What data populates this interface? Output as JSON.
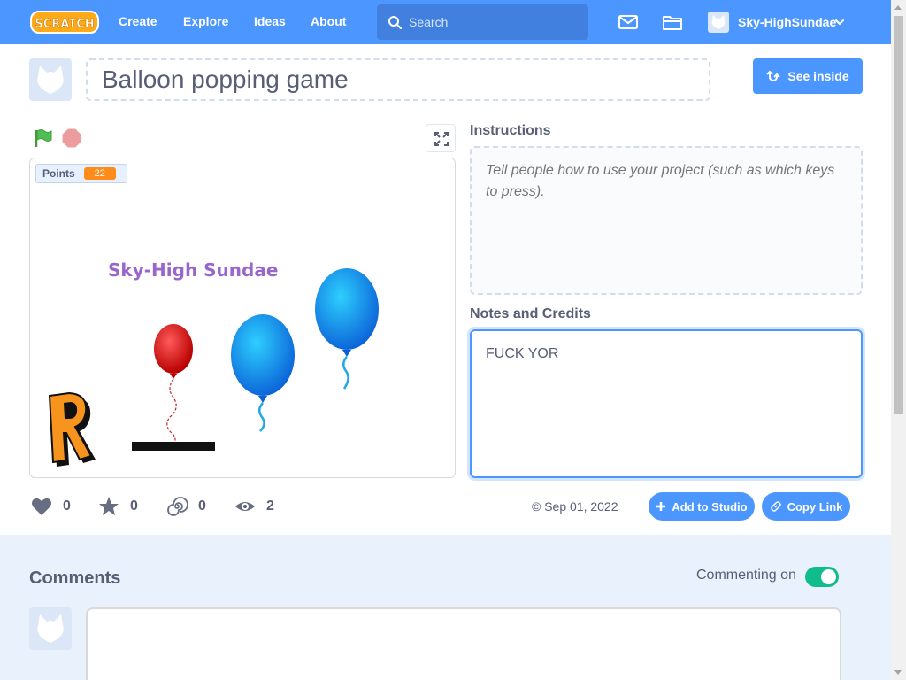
{
  "nav": {
    "logo_text": "SCRATCH",
    "links": [
      "Create",
      "Explore",
      "Ideas",
      "About"
    ],
    "search_placeholder": "Search",
    "username": "Sky-HighSundae"
  },
  "project": {
    "title": "Balloon popping game",
    "see_inside_label": "See inside"
  },
  "stage": {
    "monitor_label": "Points",
    "monitor_value": "22",
    "text": "Sky-High Sundae"
  },
  "instructions": {
    "heading": "Instructions",
    "placeholder": "Tell people how to use your project (such as which keys to press)."
  },
  "notes": {
    "heading": "Notes and Credits",
    "value": "FUCK YOR"
  },
  "stats": {
    "loves": "0",
    "favorites": "0",
    "remixes": "0",
    "views": "2"
  },
  "share": {
    "date": "© Sep 01, 2022",
    "add_to_studio_label": "Add to Studio",
    "copy_link_label": "Copy Link"
  },
  "comments": {
    "title": "Comments",
    "commenting_label": "Commenting on",
    "commenting_enabled": true
  },
  "colors": {
    "brand_blue": "#4c97ff",
    "toggle_green": "#0fbd8c",
    "monitor_orange": "#ff8c1a",
    "stage_text_purple": "#9966cc"
  },
  "icons": [
    "scratch-logo",
    "search-icon",
    "messages-icon",
    "my-stuff-folder-icon",
    "user-avatar",
    "chevron-down-icon",
    "remix-icon",
    "green-flag-icon",
    "stop-icon",
    "fullscreen-icon",
    "heart-icon",
    "star-icon",
    "remix-spiral-icon",
    "eye-icon",
    "plus-icon",
    "link-icon"
  ]
}
